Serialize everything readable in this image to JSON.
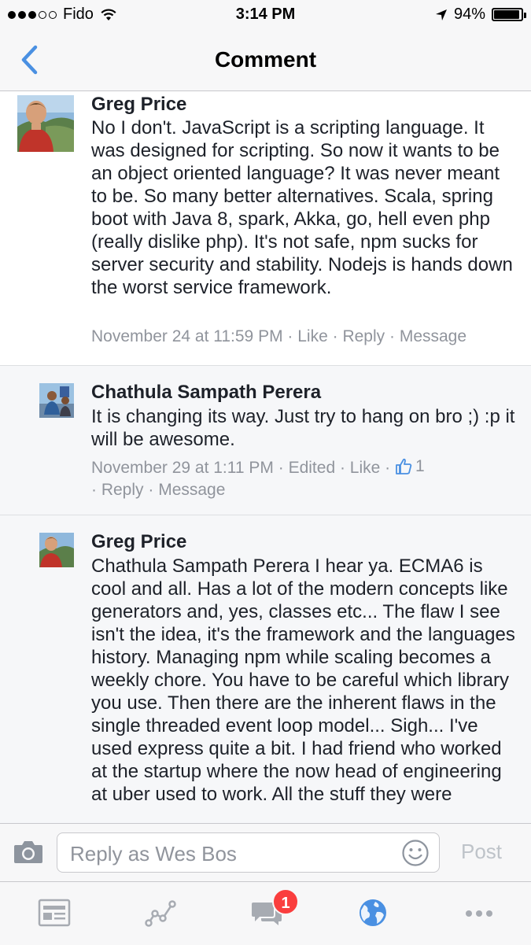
{
  "status_bar": {
    "carrier": "Fido",
    "time": "3:14 PM",
    "battery": "94%",
    "battery_level": 0.94
  },
  "nav": {
    "title": "Comment",
    "back_icon": "chevron-left-icon"
  },
  "comments": [
    {
      "author": "Greg Price",
      "text": "No I don't. JavaScript is a scripting language. It was designed for scripting. So now it wants to be an object oriented language? It was never meant to be. So many better alternatives. Scala, spring boot with Java 8, spark, Akka, go, hell even php (really dislike php). It's not safe, npm sucks for server security and stability. Nodejs is hands down the worst service framework.",
      "time": "November 24 at 11:59 PM",
      "like": "Like",
      "reply": "Reply",
      "message": "Message",
      "sep": " · "
    },
    {
      "author": "Chathula Sampath Perera",
      "text": "It is changing its way. Just try to hang on bro ;) :p it will be awesome.",
      "time": "November 29 at 1:11 PM",
      "edited": "Edited",
      "like": "Like",
      "like_count": "1",
      "reply": "Reply",
      "message": "Message",
      "sep": " · "
    },
    {
      "author": "Greg Price",
      "text": "Chathula Sampath Perera I hear ya. ECMA6 is cool and all. Has a lot of the modern concepts like generators and, yes, classes etc... The flaw I see isn't the idea, it's the framework and the languages history. Managing npm while scaling becomes a weekly chore. You have to be careful which library you use. Then there are the inherent flaws in the single threaded event loop model... Sigh... I've used express quite a bit. I had friend who worked at the startup where the now head of engineering at uber used to work. All the stuff they were"
    }
  ],
  "composer": {
    "placeholder": "Reply as Wes Bos",
    "post_label": "Post"
  },
  "tab_bar": {
    "items": [
      {
        "icon": "news-feed-icon"
      },
      {
        "icon": "activity-chart-icon"
      },
      {
        "icon": "messages-icon",
        "badge": "1"
      },
      {
        "icon": "globe-icon"
      },
      {
        "icon": "more-icon"
      }
    ]
  },
  "colors": {
    "accent": "#4a90e2",
    "meta_text": "#90949c",
    "badge": "#fa3e3e",
    "comment_bg_gray": "#f6f7f9"
  }
}
